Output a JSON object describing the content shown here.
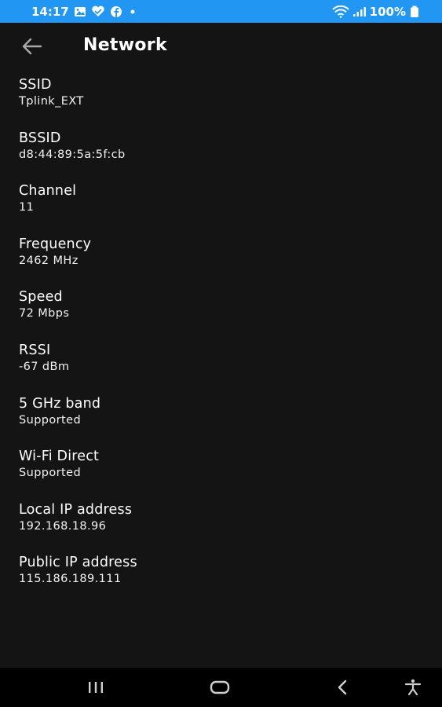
{
  "status_bar": {
    "time": "14:17",
    "battery": "100%",
    "left_icons": [
      "gallery-icon",
      "heart-icon",
      "facebook-icon",
      "dot-icon"
    ],
    "right_icons": [
      "wifi-icon",
      "signal-icon",
      "battery-icon"
    ]
  },
  "app_bar": {
    "title": "Network",
    "back_icon": "arrow-left-icon"
  },
  "items": [
    {
      "label": "SSID",
      "value": "Tplink_EXT"
    },
    {
      "label": "BSSID",
      "value": "d8:44:89:5a:5f:cb"
    },
    {
      "label": "Channel",
      "value": "11"
    },
    {
      "label": "Frequency",
      "value": "2462 MHz"
    },
    {
      "label": "Speed",
      "value": "72 Mbps"
    },
    {
      "label": "RSSI",
      "value": "-67 dBm"
    },
    {
      "label": "5 GHz band",
      "value": "Supported"
    },
    {
      "label": "Wi-Fi Direct",
      "value": "Supported"
    },
    {
      "label": "Local IP address",
      "value": "192.168.18.96"
    },
    {
      "label": "Public IP address",
      "value": "115.186.189.111"
    }
  ],
  "nav_bar": {
    "buttons": [
      "recents-icon",
      "home-icon",
      "back-icon",
      "accessibility-icon"
    ]
  },
  "colors": {
    "status_bar": "#2196f3",
    "background": "#141414",
    "nav_bar": "#000000",
    "text": "#ffffff"
  }
}
